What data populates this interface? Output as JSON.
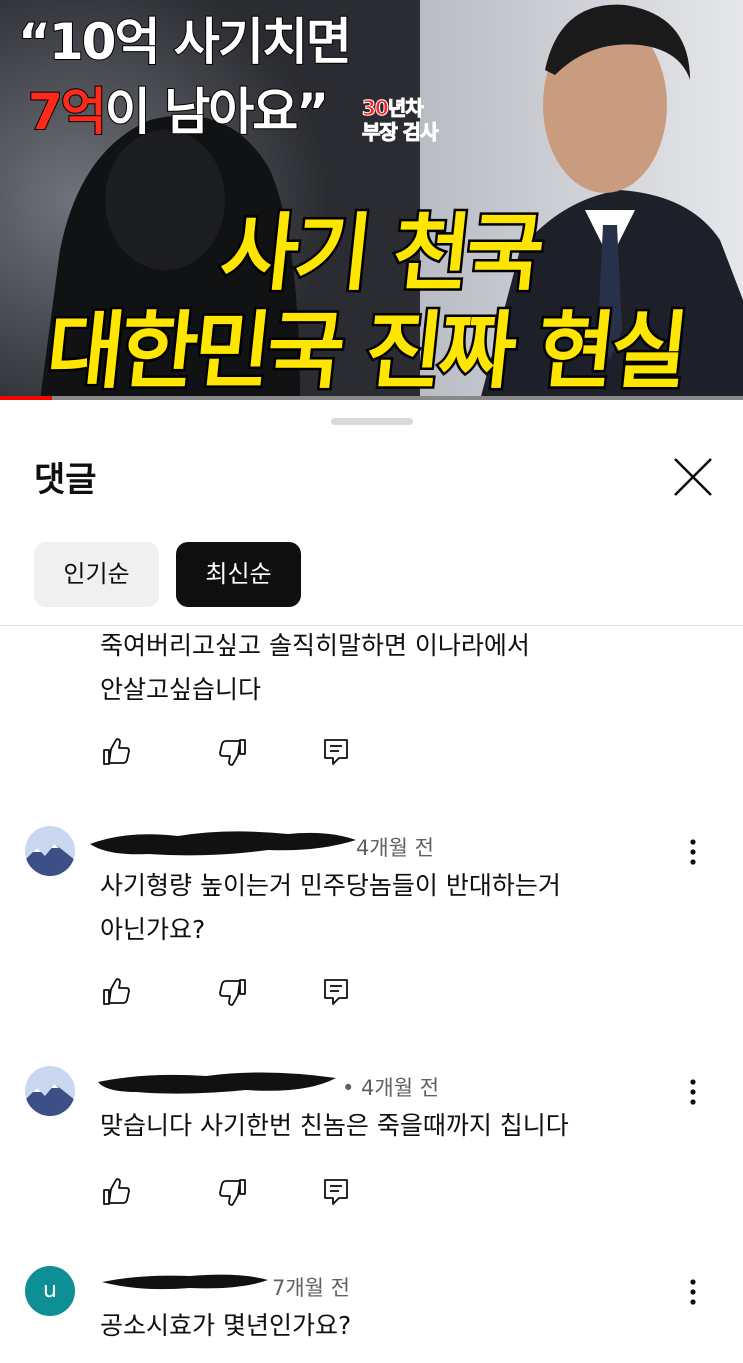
{
  "video": {
    "quote_line1": "“10억 사기치면",
    "quote_line2_highlight": "7억",
    "quote_line2_rest": "이 남아요”",
    "tag_line1": "30년차",
    "tag_line2": "부장 검사",
    "headline_line1": "사기 천국",
    "headline_line2": "대한민국 진짜 현실",
    "progress_fraction": 0.07
  },
  "panel": {
    "title": "댓글",
    "close_icon": "close-icon",
    "sort_tabs": [
      {
        "label": "인기순",
        "selected": false
      },
      {
        "label": "최신순",
        "selected": true
      }
    ]
  },
  "comments": [
    {
      "lines": [
        "죽여버리고싶고 솔직히말하면 이나라에서",
        "안살고싶습니다"
      ]
    },
    {
      "author": "",
      "time": "4개월 전",
      "lines": [
        "사기형량 높이는거 민주당놈들이 반대하는거",
        "아닌가요?"
      ]
    },
    {
      "author": "",
      "time": "• 4개월 전",
      "lines": [
        "맞습니다 사기한번 친놈은 죽을때까지 칩니다"
      ]
    },
    {
      "author_initial": "u",
      "time": "7개월 전",
      "lines": [
        "공소시효가 몇년인가요?"
      ]
    }
  ],
  "colors": {
    "accent": "#ff0000",
    "headline_yellow": "#ffe600",
    "chip_selected_bg": "#0f0f0f",
    "chip_bg": "#f0f0f0",
    "avatar_u": "#0e8e95"
  }
}
